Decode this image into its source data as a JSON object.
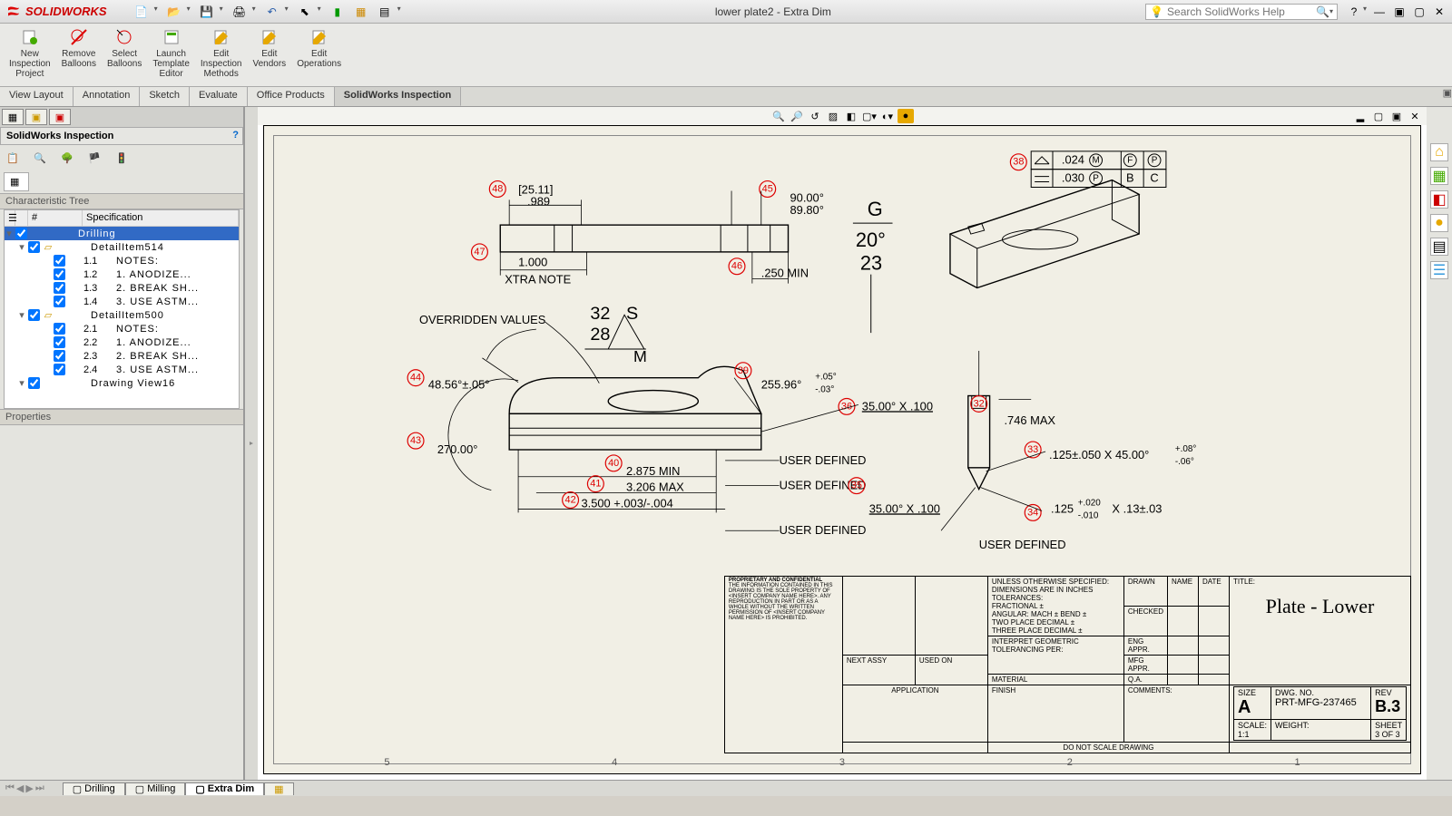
{
  "app": {
    "brand": "SOLIDWORKS",
    "doc_title": "lower plate2 - Extra Dim"
  },
  "search": {
    "placeholder": "Search SolidWorks Help"
  },
  "ribbon": {
    "buttons": [
      {
        "label": "New\nInspection\nProject"
      },
      {
        "label": "Remove\nBalloons"
      },
      {
        "label": "Select\nBalloons"
      },
      {
        "label": "Launch\nTemplate\nEditor"
      },
      {
        "label": "Edit\nInspection\nMethods"
      },
      {
        "label": "Edit\nVendors"
      },
      {
        "label": "Edit\nOperations"
      }
    ]
  },
  "cmdtabs": [
    "View Layout",
    "Annotation",
    "Sketch",
    "Evaluate",
    "Office Products",
    "SolidWorks Inspection"
  ],
  "cmdtabs_active": 5,
  "left": {
    "title": "SolidWorks Inspection",
    "section1": "Characteristic Tree",
    "section2": "Properties",
    "headers": {
      "num": "#",
      "spec": "Specification"
    },
    "rows": [
      {
        "indent": 0,
        "sel": true,
        "cb": true,
        "y": false,
        "num": "",
        "spec": "Drilling"
      },
      {
        "indent": 1,
        "cb": true,
        "y": true,
        "num": "",
        "spec": "DetailItem514"
      },
      {
        "indent": 2,
        "cb": true,
        "num": "1.1",
        "spec": "NOTES:"
      },
      {
        "indent": 2,
        "cb": true,
        "num": "1.2",
        "spec": "1. ANODIZE..."
      },
      {
        "indent": 2,
        "cb": true,
        "num": "1.3",
        "spec": "2. BREAK SH..."
      },
      {
        "indent": 2,
        "cb": true,
        "num": "1.4",
        "spec": "3. USE ASTM..."
      },
      {
        "indent": 1,
        "cb": true,
        "y": true,
        "num": "",
        "spec": "DetailItem500"
      },
      {
        "indent": 2,
        "cb": true,
        "num": "2.1",
        "spec": "NOTES:"
      },
      {
        "indent": 2,
        "cb": true,
        "num": "2.2",
        "spec": "1. ANODIZE..."
      },
      {
        "indent": 2,
        "cb": true,
        "num": "2.3",
        "spec": "2. BREAK SH..."
      },
      {
        "indent": 2,
        "cb": true,
        "num": "2.4",
        "spec": "3. USE ASTM..."
      },
      {
        "indent": 1,
        "cb": true,
        "y": false,
        "num": "",
        "spec": "Drawing View16"
      }
    ]
  },
  "dwg": {
    "overridden": "OVERRIDDEN VALUES",
    "b48": "48",
    "d48a": "[25.11]",
    "d48b": ".989",
    "b47": "47",
    "d47": "1.000",
    "xtra": "XTRA NOTE",
    "b45": "45",
    "b46": "46",
    "d46": ".250 MIN",
    "ang1": "90.00°",
    "ang2": "89.80°",
    "G": "G",
    "g1": "20°",
    "g2": "23",
    "s1": "32",
    "s2": "28",
    "sS": "S",
    "sM": "M",
    "b44": "44",
    "d44": "48.56°±.05°",
    "b43": "43",
    "d43": "270.00°",
    "b40": "40",
    "b41": "41",
    "b42": "42",
    "d40": "2.875 MIN",
    "d41": "3.206 MAX",
    "d42": "3.500 +.003/-.004",
    "ud": "USER DEFINED",
    "b39": "39",
    "d39": "255.96°",
    "d39a": "+.05°",
    "d39b": "-.03°",
    "b36": "36",
    "d36": "35.00° X .100",
    "b35": "35",
    "d35": "35.00° X .100",
    "b38": "38",
    "fcf1": ".024",
    "fcf2": ".030",
    "fcfM": "M",
    "fcfF": "F",
    "fcfP": "P",
    "fcfB": "B",
    "fcfC": "C",
    "b32": "32",
    "d32": ".746 MAX",
    "b33": "33",
    "d33a": ".125±.050 X 45.00°",
    "d33b": "+.08°",
    "d33c": "-.06°",
    "b34": "34",
    "d34a": ".125",
    "d34b": "+.020",
    "d34c": "-.010",
    "d34d": "X .13±.03",
    "tb": {
      "unless": "UNLESS OTHERWISE SPECIFIED:",
      "diminch": "DIMENSIONS ARE IN INCHES",
      "tol": "TOLERANCES:",
      "frac": "FRACTIONAL ±",
      "ang": "ANGULAR: MACH ±    BEND ±",
      "two": "TWO PLACE DECIMAL   ±",
      "three": "THREE PLACE DECIMAL  ±",
      "geo": "INTERPRET GEOMETRIC",
      "tolper": "TOLERANCING PER:",
      "mat": "MATERIAL",
      "fin": "FINISH",
      "prop": "PROPRIETARY AND CONFIDENTIAL",
      "propbody": "THE INFORMATION CONTAINED IN THIS DRAWING IS THE SOLE PROPERTY OF <INSERT COMPANY NAME HERE>. ANY REPRODUCTION IN PART OR AS A WHOLE WITHOUT THE WRITTEN PERMISSION OF <INSERT COMPANY NAME HERE> IS PROHIBITED.",
      "nextassy": "NEXT ASSY",
      "usedon": "USED ON",
      "app": "APPLICATION",
      "dns": "DO NOT SCALE DRAWING",
      "name": "NAME",
      "date": "DATE",
      "drawn": "DRAWN",
      "checked": "CHECKED",
      "enga": "ENG APPR.",
      "mfga": "MFG APPR.",
      "qa": "Q.A.",
      "comm": "COMMENTS:",
      "titlelab": "TITLE:",
      "title": "Plate - Lower",
      "sizelab": "SIZE",
      "size": "A",
      "dwgnolab": "DWG. NO.",
      "dwgno": "PRT-MFG-237465",
      "revlab": "REV",
      "rev": "B.3",
      "scale": "SCALE: 1:1",
      "weight": "WEIGHT:",
      "sheet": "SHEET 3 OF 3"
    },
    "ruler": [
      "5",
      "4",
      "3",
      "2",
      "1"
    ]
  },
  "sheets": {
    "tabs": [
      "Drilling",
      "Milling",
      "Extra Dim"
    ],
    "active": 2
  }
}
